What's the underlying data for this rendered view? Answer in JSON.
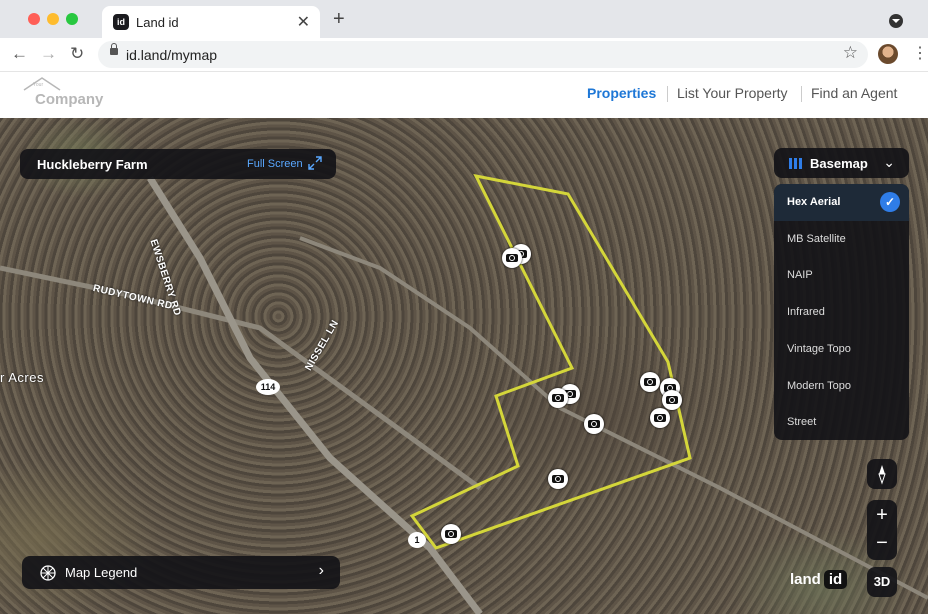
{
  "browser": {
    "tab_title": "Land id",
    "favicon_text": "id",
    "url": "id.land/mymap",
    "traffic_colors": [
      "#ff5f57",
      "#febc2e",
      "#28c840"
    ]
  },
  "header": {
    "logo_text": "Company",
    "logo_small": "Your",
    "nav": [
      {
        "label": "Properties",
        "active": true
      },
      {
        "label": "List Your Property",
        "active": false
      },
      {
        "label": "Find an Agent",
        "active": false
      }
    ]
  },
  "map": {
    "property_name": "Huckleberry Farm",
    "full_screen_label": "Full Screen",
    "basemap": {
      "label": "Basemap",
      "options": [
        "Hex Aerial",
        "MB Satellite",
        "NAIP",
        "Infrared",
        "Vintage Topo",
        "Modern Topo",
        "Street"
      ],
      "selected": "Hex Aerial"
    },
    "legend_label": "Map Legend",
    "view_3d_label": "3D",
    "zoom_in": "+",
    "zoom_out": "−",
    "brand_text": "land",
    "brand_id": "id",
    "boundary_color": "#d4d63a",
    "accent_color": "#1e77d6",
    "labels": {
      "road_lewsberry": "EWSBERRY RD",
      "road_rudytown": "RUDYTOWN RD",
      "road_nissel": "NISSEL LN",
      "place_acres": "r Acres",
      "route_114": "114",
      "route_114_b": "1"
    }
  }
}
